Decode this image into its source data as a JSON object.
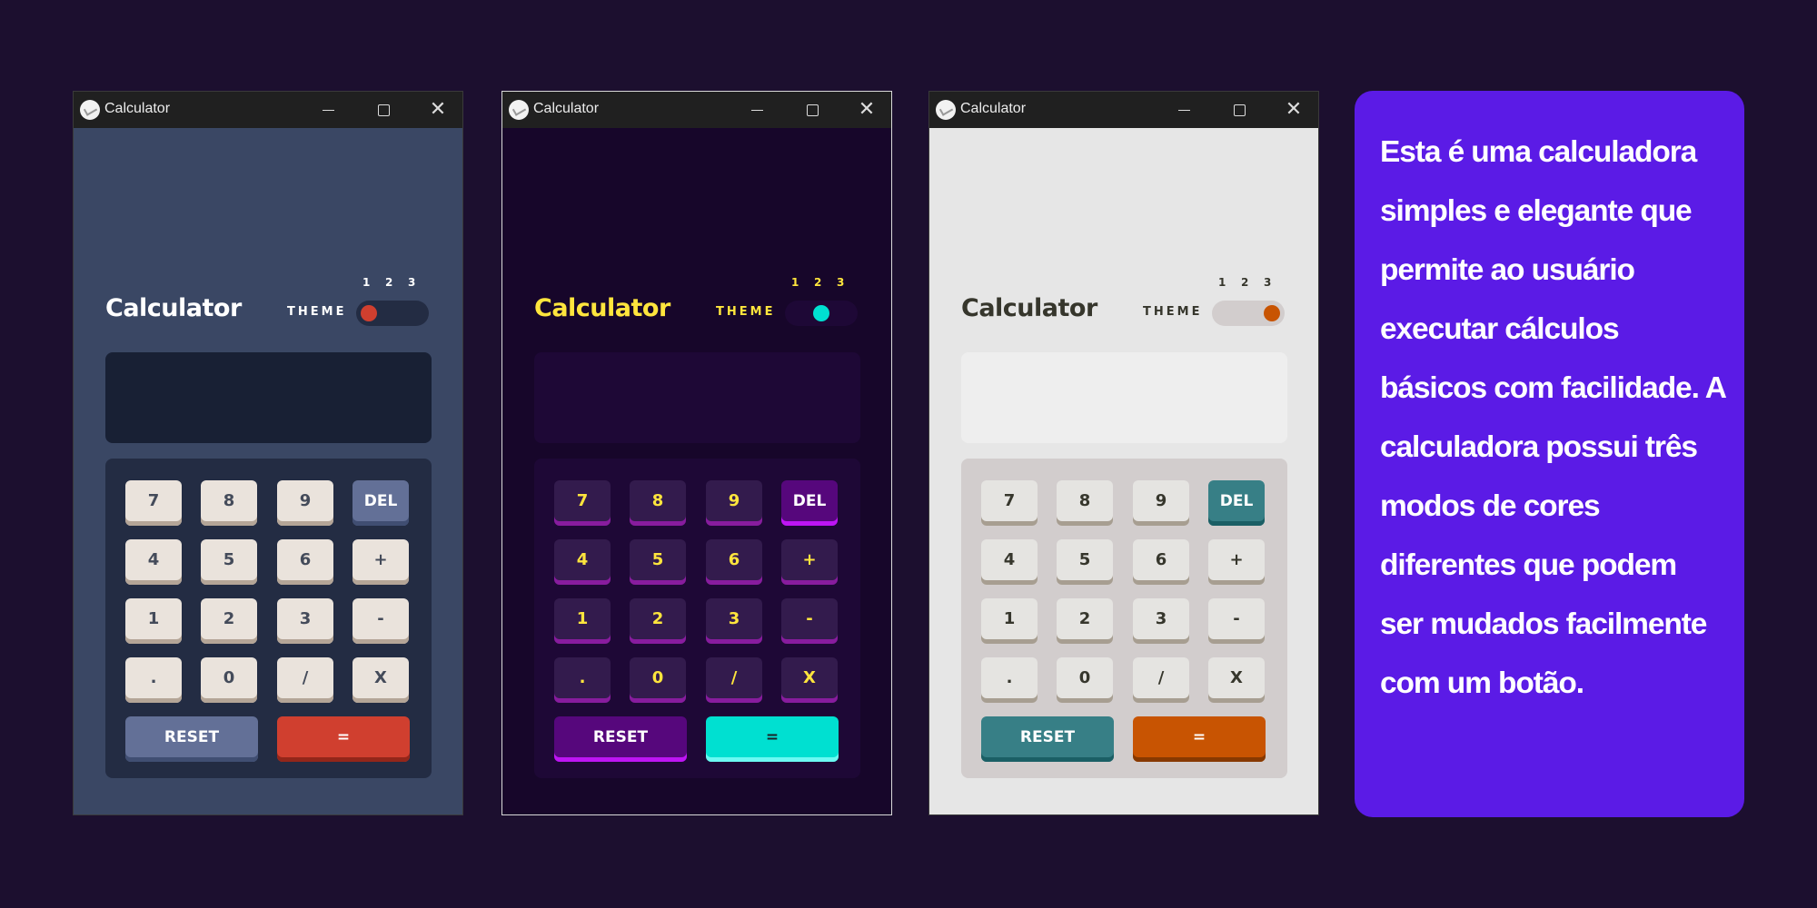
{
  "windows": [
    {
      "window_title": "Calculator",
      "calc_title": "Calculator",
      "theme_label": "THEME",
      "theme_numbers": [
        "1",
        "2",
        "3"
      ],
      "selected_theme": "1",
      "display_value": ""
    },
    {
      "window_title": "Calculator",
      "calc_title": "Calculator",
      "theme_label": "THEME",
      "theme_numbers": [
        "1",
        "2",
        "3"
      ],
      "selected_theme": "2",
      "display_value": ""
    },
    {
      "window_title": "Calculator",
      "calc_title": "Calculator",
      "theme_label": "THEME",
      "theme_numbers": [
        "1",
        "2",
        "3"
      ],
      "selected_theme": "3",
      "display_value": ""
    }
  ],
  "keys": [
    "7",
    "8",
    "9",
    "DEL",
    "4",
    "5",
    "6",
    "+",
    "1",
    "2",
    "3",
    "-",
    ".",
    "0",
    "/",
    "X"
  ],
  "reset_label": "RESET",
  "equals_label": "=",
  "icons": {
    "window_controls": [
      "minimize-icon",
      "maximize-icon",
      "close-icon"
    ],
    "app": "calculator-app-icon"
  },
  "colors": {
    "background": "#1c0f2f",
    "info_panel": "#5b1be6",
    "theme1_accent": "#d03f2f",
    "theme2_accent": "#00e0d1",
    "theme3_accent": "#c85402"
  },
  "description": "Esta é uma calculadora simples e elegante que permite ao usuário executar cálculos básicos com facilidade. A calculadora possui três modos de cores diferentes que podem ser mudados facilmente com um botão."
}
